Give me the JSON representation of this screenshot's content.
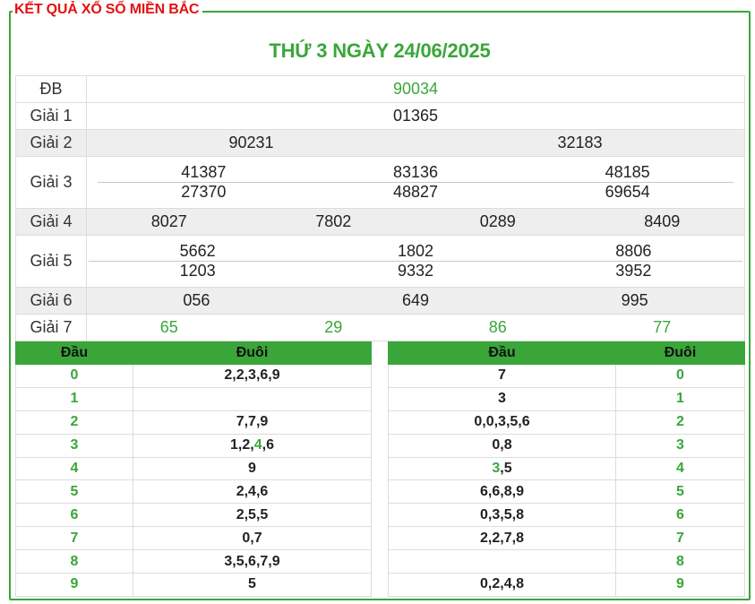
{
  "header": {
    "frame_title": "KẾT QUẢ XỔ SỐ MIỀN BẮC",
    "date_title": "THỨ 3 NGÀY 24/06/2025"
  },
  "prizes": {
    "db": {
      "label": "ĐB",
      "values": [
        "90034"
      ]
    },
    "g1": {
      "label": "Giải 1",
      "values": [
        "01365"
      ]
    },
    "g2": {
      "label": "Giải 2",
      "values": [
        "90231",
        "32183"
      ]
    },
    "g3": {
      "label": "Giải 3",
      "values": [
        "41387",
        "83136",
        "48185",
        "27370",
        "48827",
        "69654"
      ]
    },
    "g4": {
      "label": "Giải 4",
      "values": [
        "8027",
        "7802",
        "0289",
        "8409"
      ]
    },
    "g5": {
      "label": "Giải 5",
      "values": [
        "5662",
        "1802",
        "8806",
        "1203",
        "9332",
        "3952"
      ]
    },
    "g6": {
      "label": "Giải 6",
      "values": [
        "056",
        "649",
        "995"
      ]
    },
    "g7": {
      "label": "Giải 7",
      "values": [
        "65",
        "29",
        "86",
        "77"
      ]
    }
  },
  "loto_left": {
    "head_label": "Đầu",
    "tail_label": "Đuôi",
    "rows": [
      {
        "key": "0",
        "parts": [
          "2,2,3,6,9"
        ]
      },
      {
        "key": "1",
        "parts": [
          ""
        ]
      },
      {
        "key": "2",
        "parts": [
          "7,7,9"
        ]
      },
      {
        "key": "3",
        "parts": [
          "1,2,",
          "4",
          ",6"
        ]
      },
      {
        "key": "4",
        "parts": [
          "9"
        ]
      },
      {
        "key": "5",
        "parts": [
          "2,4,6"
        ]
      },
      {
        "key": "6",
        "parts": [
          "2,5,5"
        ]
      },
      {
        "key": "7",
        "parts": [
          "0,7"
        ]
      },
      {
        "key": "8",
        "parts": [
          "3,5,6,7,9"
        ]
      },
      {
        "key": "9",
        "parts": [
          "5"
        ]
      }
    ]
  },
  "loto_right": {
    "head_label": "Đầu",
    "tail_label": "Đuôi",
    "rows": [
      {
        "key": "0",
        "parts": [
          "7"
        ]
      },
      {
        "key": "1",
        "parts": [
          "3"
        ]
      },
      {
        "key": "2",
        "parts": [
          "0,0,3,5,6"
        ]
      },
      {
        "key": "3",
        "parts": [
          "0,8"
        ]
      },
      {
        "key": "4",
        "parts": [
          "",
          "3",
          ",5"
        ]
      },
      {
        "key": "5",
        "parts": [
          "6,6,8,9"
        ]
      },
      {
        "key": "6",
        "parts": [
          "0,3,5,8"
        ]
      },
      {
        "key": "7",
        "parts": [
          "2,2,7,8"
        ]
      },
      {
        "key": "8",
        "parts": [
          ""
        ]
      },
      {
        "key": "9",
        "parts": [
          "0,2,4,8"
        ]
      }
    ]
  },
  "colors": {
    "accent": "#3aa63a",
    "title_red": "#e31212",
    "shade": "#eeeeee"
  }
}
